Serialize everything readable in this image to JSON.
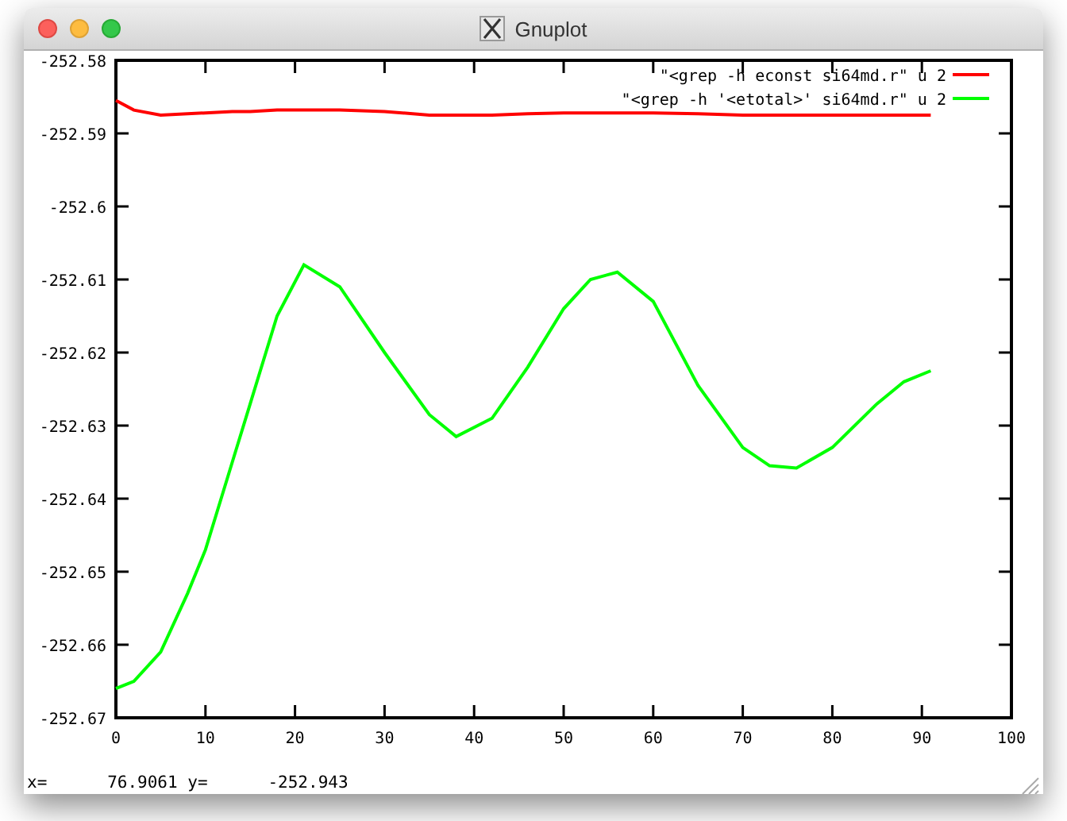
{
  "window": {
    "title": "Gnuplot"
  },
  "plot": {
    "chart_data": {
      "type": "line",
      "x": [
        0,
        2,
        5,
        8,
        10,
        13,
        15,
        18,
        21,
        25,
        30,
        35,
        38,
        42,
        46,
        50,
        53,
        56,
        60,
        65,
        70,
        73,
        76,
        80,
        85,
        88,
        91
      ],
      "series": [
        {
          "name": "\"<grep -h econst si64md.r\" u 2",
          "color": "#ff0000",
          "values": [
            -252.5855,
            -252.5868,
            -252.5875,
            -252.5873,
            -252.5872,
            -252.587,
            -252.587,
            -252.5868,
            -252.5868,
            -252.5868,
            -252.587,
            -252.5875,
            -252.5875,
            -252.5875,
            -252.5873,
            -252.5872,
            -252.5872,
            -252.5872,
            -252.5872,
            -252.5873,
            -252.5875,
            -252.5875,
            -252.5875,
            -252.5875,
            -252.5875,
            -252.5875,
            -252.5875
          ]
        },
        {
          "name": "\"<grep -h '<etotal>' si64md.r\" u 2",
          "color": "#00ff00",
          "values": [
            -252.666,
            -252.665,
            -252.661,
            -252.653,
            -252.647,
            -252.635,
            -252.627,
            -252.615,
            -252.608,
            -252.611,
            -252.62,
            -252.6285,
            -252.6315,
            -252.629,
            -252.622,
            -252.614,
            -252.61,
            -252.609,
            -252.613,
            -252.6245,
            -252.633,
            -252.6355,
            -252.6358,
            -252.633,
            -252.627,
            -252.624,
            -252.6225
          ]
        }
      ],
      "legend": true,
      "xlim": [
        0,
        100
      ],
      "ylim": [
        -252.67,
        -252.58
      ],
      "xticks": [
        0,
        10,
        20,
        30,
        40,
        50,
        60,
        70,
        80,
        90,
        100
      ],
      "yticks": [
        -252.67,
        -252.66,
        -252.65,
        -252.64,
        -252.63,
        -252.62,
        -252.61,
        {
          "value": -252.6,
          "label": "-252.6"
        },
        -252.59,
        -252.58
      ]
    }
  },
  "status_bar": {
    "text": "x=      76.9061 y=      -252.943"
  }
}
